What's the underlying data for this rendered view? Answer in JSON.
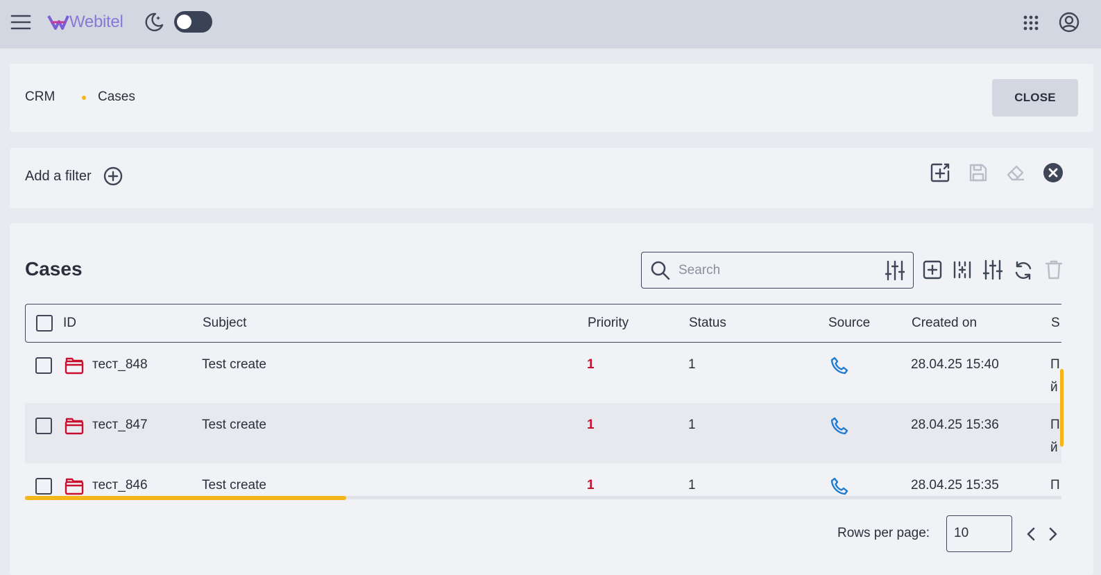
{
  "header": {
    "brand": "Webitel",
    "icons": [
      "menu-icon",
      "theme-moon-icon",
      "apps-grid-icon",
      "account-icon"
    ],
    "theme_toggle_on": false
  },
  "breadcrumbs": {
    "items": [
      "CRM",
      "Cases"
    ],
    "close_label": "CLOSE"
  },
  "filters": {
    "add_label": "Add a filter",
    "actions": [
      "import-icon",
      "save-icon",
      "eraser-icon",
      "clear-icon"
    ]
  },
  "main": {
    "title": "Cases",
    "search": {
      "placeholder": "Search",
      "value": ""
    },
    "toolbar": [
      "add-icon",
      "columns-icon",
      "settings-icon",
      "refresh-icon",
      "delete-icon"
    ]
  },
  "table": {
    "columns": [
      "ID",
      "Subject",
      "Priority",
      "Status",
      "Source",
      "Created on",
      "S"
    ],
    "rows": [
      {
        "id": "тест_848",
        "subject": "Test create",
        "priority": "1",
        "status": "1",
        "source": "phone-icon",
        "created": "28.04.25 15:40",
        "extra": "Пй"
      },
      {
        "id": "тест_847",
        "subject": "Test create",
        "priority": "1",
        "status": "1",
        "source": "phone-icon",
        "created": "28.04.25 15:36",
        "extra": "Пй"
      },
      {
        "id": "тест_846",
        "subject": "Test create",
        "priority": "1",
        "status": "1",
        "source": "phone-icon",
        "created": "28.04.25 15:35",
        "extra": "П"
      }
    ]
  },
  "pagination": {
    "rows_label": "Rows per page:",
    "rows_value": "10"
  },
  "colors": {
    "accent": "#f5b61c",
    "priority": "#c8102e",
    "phone": "#1f7bd1",
    "case_icon": "#c8102e",
    "brand": "#8b78d6"
  }
}
